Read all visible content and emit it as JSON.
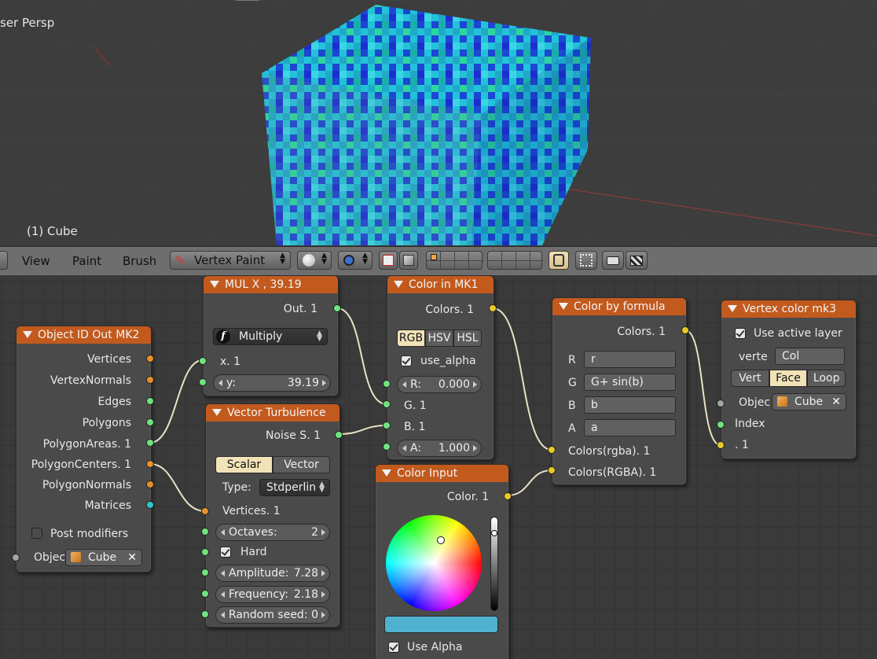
{
  "viewport": {
    "view_label": "ser Persp",
    "object_label": "(1) Cube"
  },
  "header": {
    "menus": [
      "View",
      "Paint",
      "Brush"
    ],
    "mode_label": "Vertex Paint"
  },
  "nodes": {
    "object_id_out": {
      "title": "Object ID Out MK2",
      "outputs": [
        "Vertices",
        "VertexNormals",
        "Edges",
        "Polygons",
        "PolygonAreas. 1",
        "PolygonCenters. 1",
        "PolygonNormals",
        "Matrices"
      ],
      "post_modifiers_label": "Post modifiers",
      "object_label": "Objec",
      "object_value": "Cube"
    },
    "mul": {
      "title": "MUL X ,  39.19",
      "output": "Out. 1",
      "operation": "Multiply",
      "input_x": "x. 1",
      "y_label": "y:",
      "y_value": "39.19"
    },
    "vector_turbulence": {
      "title": "Vector Turbulence",
      "output": "Noise S. 1",
      "mode_options": [
        "Scalar",
        "Vector"
      ],
      "type_label": "Type:",
      "type_value": "Stdperlin",
      "input_vertices": "Vertices. 1",
      "octaves_label": "Octaves:",
      "octaves_value": "2",
      "hard_label": "Hard",
      "amplitude_label": "Amplitude:",
      "amplitude_value": "7.28",
      "frequency_label": "Frequency:",
      "frequency_value": "2.18",
      "seed_label": "Random seed:",
      "seed_value": "0"
    },
    "color_in": {
      "title": "Color in MK1",
      "output": "Colors. 1",
      "modes": [
        "RGB",
        "HSV",
        "HSL"
      ],
      "use_alpha_label": "use_alpha",
      "r_label": "R:",
      "r_value": "0.000",
      "g_label": "G. 1",
      "b_label": "B. 1",
      "a_label": "A:",
      "a_value": "1.000"
    },
    "color_input": {
      "title": "Color Input",
      "output": "Color. 1",
      "swatch_color": "#4fb1d0",
      "use_alpha_label": "Use Alpha"
    },
    "color_by_formula": {
      "title": "Color by formula",
      "output": "Colors. 1",
      "rows": [
        {
          "label": "R",
          "value": "r"
        },
        {
          "label": "G",
          "value": "G+ sin(b)"
        },
        {
          "label": "B",
          "value": "b"
        },
        {
          "label": "A",
          "value": "a"
        }
      ],
      "input_rgba": "Colors(rgba). 1",
      "input_RGBA": "Colors(RGBA). 1"
    },
    "vertex_color": {
      "title": "Vertex color mk3",
      "use_active_layer_label": "Use active layer",
      "verte_label": "verte",
      "verte_value": "Col",
      "modes": [
        "Vert",
        "Face",
        "Loop"
      ],
      "object_label": "Objec",
      "object_value": "Cube",
      "index_label": "Index",
      "input_label": ". 1"
    }
  },
  "colors": {
    "node_header": "#c25a1e",
    "socket_orange": "#e8902a",
    "socket_green": "#6fe37f",
    "socket_yellow": "#e9c928",
    "socket_cyan": "#2fc5d0",
    "cube_cyan": "#22c6d6",
    "cube_blue": "#1b3fd6"
  }
}
